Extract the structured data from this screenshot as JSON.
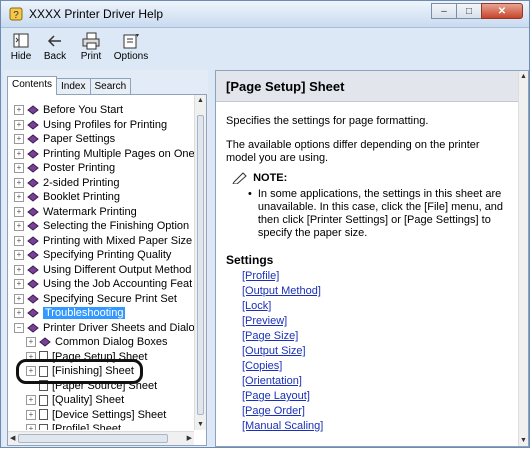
{
  "window": {
    "title": "XXXX Printer Driver Help",
    "buttons": {
      "minimize": "–",
      "maximize": "□",
      "close": "✕"
    }
  },
  "toolbar": {
    "hide": "Hide",
    "back": "Back",
    "print": "Print",
    "options": "Options"
  },
  "left_tabs": [
    "Contents",
    "Index",
    "Search"
  ],
  "tree": [
    {
      "label": "Before You Start",
      "expander": "+"
    },
    {
      "label": "Using Profiles for Printing",
      "expander": "+"
    },
    {
      "label": "Paper Settings",
      "expander": "+"
    },
    {
      "label": "Printing Multiple Pages on One",
      "expander": "+"
    },
    {
      "label": "Poster Printing",
      "expander": "+"
    },
    {
      "label": "2-sided Printing",
      "expander": "+"
    },
    {
      "label": "Booklet Printing",
      "expander": "+"
    },
    {
      "label": "Watermark Printing",
      "expander": "+"
    },
    {
      "label": "Selecting the Finishing Option",
      "expander": "+"
    },
    {
      "label": "Printing with Mixed Paper Size",
      "expander": "+"
    },
    {
      "label": "Specifying Printing Quality",
      "expander": "+"
    },
    {
      "label": "Using Different Output Method",
      "expander": "+"
    },
    {
      "label": "Using the Job Accounting Feat",
      "expander": "+"
    },
    {
      "label": "Specifying Secure Print Set",
      "expander": "+"
    },
    {
      "label": "Troubleshooting",
      "expander": "+"
    },
    {
      "label": "Printer Driver Sheets and Dialo",
      "expander": "−"
    },
    {
      "label": "Common Dialog Boxes",
      "expander": "+"
    },
    {
      "label": "[Page Setup] Sheet",
      "expander": "+"
    },
    {
      "label": "[Finishing] Sheet",
      "expander": "+"
    },
    {
      "label": "[Paper Source] Sheet",
      "expander": ""
    },
    {
      "label": "[Quality] Sheet",
      "expander": "+"
    },
    {
      "label": "[Device Settings] Sheet",
      "expander": "+"
    },
    {
      "label": "[Profile] Sheet",
      "expander": "+"
    }
  ],
  "content": {
    "title": "[Page Setup] Sheet",
    "para1": "Specifies the settings for page formatting.",
    "para2": "The available options differ depending on the printer model you are using.",
    "note_label": "NOTE:",
    "note_text": "In some applications, the settings in this sheet are unavailable. In this case, click the [File] menu, and then click [Printer Settings] or [Page Settings] to specify the paper size.",
    "settings_heading": "Settings",
    "links": [
      "[Profile]",
      "[Output Method]",
      "[Lock]",
      "[Preview]",
      "[Page Size]",
      "[Output Size]",
      "[Copies]",
      "[Orientation]",
      "[Page Layout]",
      "[Page Order]",
      "[Manual Scaling]"
    ]
  },
  "colors": {
    "link": "#1a30b8",
    "selection": "#3399ff",
    "book": "#7a3f9a"
  }
}
